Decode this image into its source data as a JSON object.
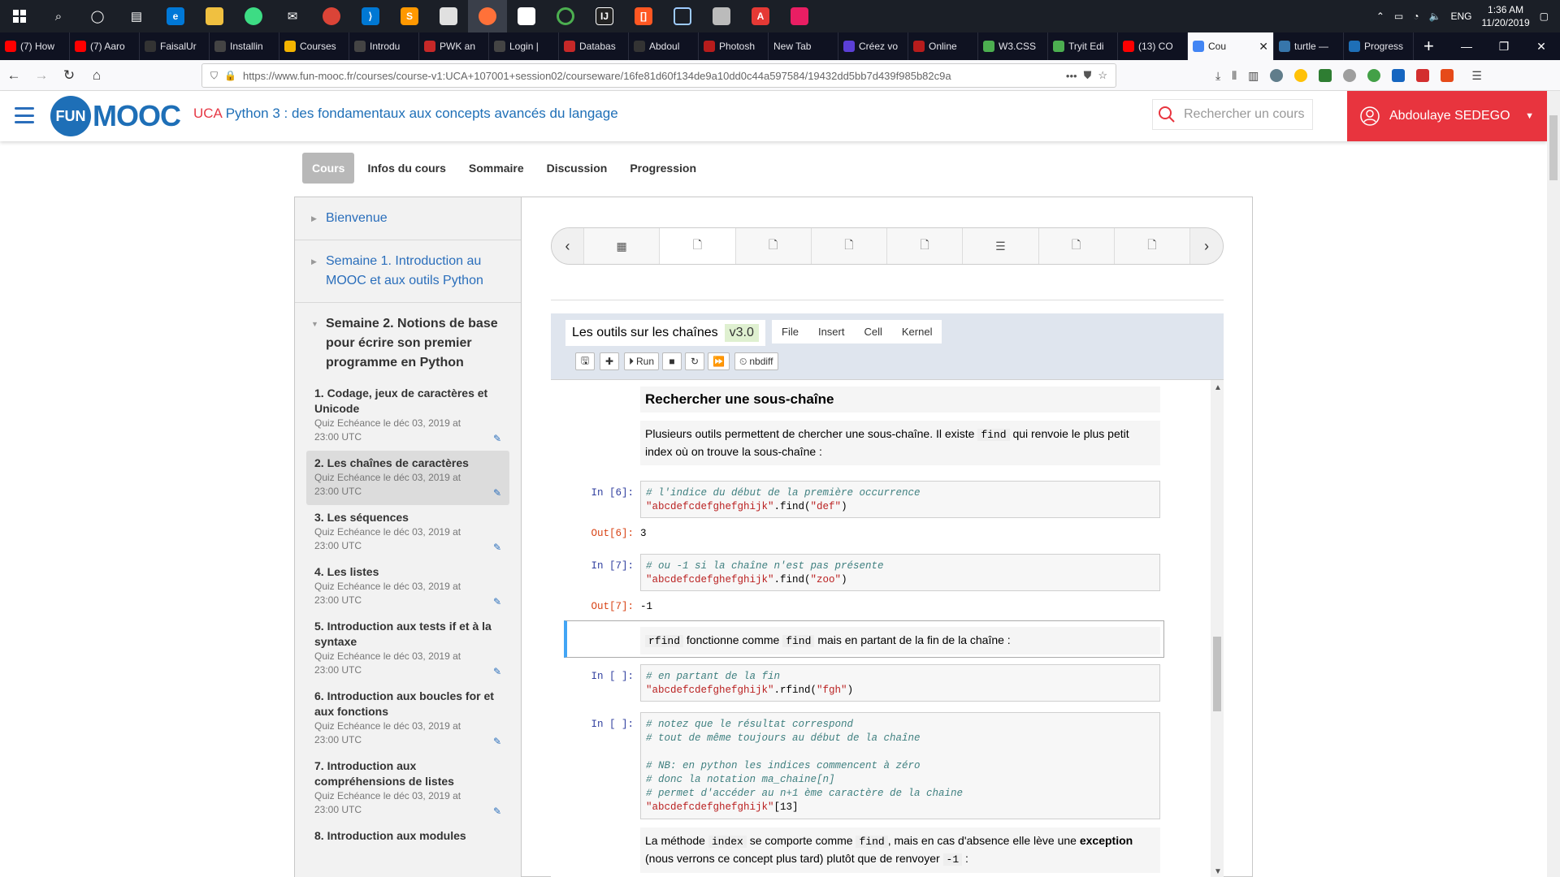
{
  "taskbar": {
    "apps": [
      "start-icon",
      "search-icon",
      "cortana-icon",
      "task-view-icon",
      "edge-icon",
      "file-explorer-icon",
      "android-studio-icon",
      "mail-icon",
      "chrome-icon",
      "vscode-icon",
      "sublime-icon",
      "file-icon",
      "firefox-icon",
      "store-icon",
      "circle-app-icon",
      "intellij-icon",
      "brackets-icon",
      "box-icon",
      "shield-app-icon",
      "pdf-icon",
      "app-icon"
    ],
    "lang": "ENG",
    "time": "1:36 AM",
    "date": "11/20/2019"
  },
  "tabs": [
    {
      "label": "(7) How",
      "icon": "youtube-icon",
      "color": "#ff0000"
    },
    {
      "label": "(7) Aaro",
      "icon": "youtube-icon",
      "color": "#ff0000"
    },
    {
      "label": "FaisalUr",
      "icon": "github-icon",
      "color": "#333333"
    },
    {
      "label": "Installin",
      "icon": "vscode-icon",
      "color": "#444444"
    },
    {
      "label": "Courses",
      "icon": "drive-icon",
      "color": "#f4b400"
    },
    {
      "label": "Introdu",
      "icon": "vscode-icon",
      "color": "#444444"
    },
    {
      "label": "PWK an",
      "icon": "pwk-icon",
      "color": "#c62828"
    },
    {
      "label": "Login | ",
      "icon": "vscode-icon",
      "color": "#444444"
    },
    {
      "label": "Databas",
      "icon": "pwk-icon",
      "color": "#c62828"
    },
    {
      "label": "Abdoul",
      "icon": "github-icon",
      "color": "#333333"
    },
    {
      "label": "Photosh",
      "icon": "photoshop-icon",
      "color": "#b71c1c"
    },
    {
      "label": "New Tab",
      "icon": "none",
      "color": "#0f1221"
    },
    {
      "label": "Créez vo",
      "icon": "canva-icon",
      "color": "#5b3fd6"
    },
    {
      "label": "Online ",
      "icon": "photoshop-icon",
      "color": "#b71c1c"
    },
    {
      "label": "W3.CSS",
      "icon": "w3-icon",
      "color": "#4caf50"
    },
    {
      "label": "Tryit Edi",
      "icon": "w3-icon",
      "color": "#4caf50"
    },
    {
      "label": "(13) CO",
      "icon": "youtube-icon",
      "color": "#ff0000"
    },
    {
      "label": "Cou",
      "icon": "chrome-icon",
      "color": "#4285f4",
      "active": true
    },
    {
      "label": "turtle —",
      "icon": "python-icon",
      "color": "#3776ab"
    },
    {
      "label": "Progress",
      "icon": "fun-icon",
      "color": "#1e6fb7"
    }
  ],
  "browser": {
    "url": "https://www.fun-mooc.fr/courses/course-v1:UCA+107001+session02/courseware/16fe81d60f134de9a10dd0c44a597584/19432dd5bb7d439f985b82c9a"
  },
  "site": {
    "logo_fun": "FUN",
    "logo_mooc": "MOOC",
    "course_prefix": "UCA",
    "course_title": "Python 3 : des fondamentaux aux concepts avancés du langage",
    "search_placeholder": "Rechercher un cours",
    "user": "Abdoulaye SEDEGO",
    "nav": [
      "Cours",
      "Infos du cours",
      "Sommaire",
      "Discussion",
      "Progression"
    ]
  },
  "sidebar": {
    "chapters": [
      {
        "label": "Bienvenue"
      },
      {
        "label": "Semaine 1. Introduction au MOOC et aux outils Python"
      },
      {
        "label": "Semaine 2. Notions de base pour écrire son premier programme en Python"
      }
    ],
    "sequences": [
      {
        "title": "1. Codage, jeux de caractères et Unicode",
        "due": "Quiz Echéance le déc 03, 2019 at 23:00 UTC"
      },
      {
        "title": "2. Les chaînes de caractères",
        "due": "Quiz Echéance le déc 03, 2019 at 23:00 UTC",
        "active": true
      },
      {
        "title": "3. Les séquences",
        "due": "Quiz Echéance le déc 03, 2019 at 23:00 UTC"
      },
      {
        "title": "4. Les listes",
        "due": "Quiz Echéance le déc 03, 2019 at 23:00 UTC"
      },
      {
        "title": "5. Introduction aux tests if et à la syntaxe",
        "due": "Quiz Echéance le déc 03, 2019 at 23:00 UTC"
      },
      {
        "title": "6. Introduction aux boucles for et aux fonctions",
        "due": "Quiz Echéance le déc 03, 2019 at 23:00 UTC"
      },
      {
        "title": "7. Introduction aux compréhensions de listes",
        "due": "Quiz Echéance le déc 03, 2019 at 23:00 UTC"
      },
      {
        "title": "8. Introduction aux modules",
        "due": ""
      }
    ]
  },
  "unit_nav": {
    "prev": "‹",
    "next": "›",
    "units": [
      "video-icon",
      "page-icon",
      "page-icon",
      "page-icon",
      "page-icon",
      "list-icon",
      "page-icon",
      "page-icon"
    ],
    "active_index": 1
  },
  "notebook": {
    "title": "Les outils sur les chaînes",
    "version": "v3.0",
    "menu": [
      "File",
      "Insert",
      "Cell",
      "Kernel"
    ],
    "tools": {
      "run": "Run",
      "nbdiff": "nbdiff"
    },
    "heading": "Rechercher une sous-chaîne",
    "md1_a": "Plusieurs outils permettent de chercher une sous-chaîne. Il existe",
    "md1_code": "find",
    "md1_b": "qui renvoie le plus petit index où on trouve la sous-chaîne :",
    "cell1": {
      "prompt": "In [6]:",
      "comment": "# l'indice du début de la première occurrence",
      "str": "\"abcdefcdefghefghijk\"",
      "method": ".find(",
      "arg": "\"def\"",
      "close": ")",
      "out_prompt": "Out[6]:",
      "out": "3"
    },
    "cell2": {
      "prompt": "In [7]:",
      "comment": "# ou -1 si la chaîne n'est pas présente",
      "str": "\"abcdefcdefghefghijk\"",
      "method": ".find(",
      "arg": "\"zoo\"",
      "close": ")",
      "out_prompt": "Out[7]:",
      "out": "-1"
    },
    "md2_code1": "rfind",
    "md2_a": "fonctionne comme",
    "md2_code2": "find",
    "md2_b": "mais en partant de la fin de la chaîne :",
    "cell3": {
      "prompt": "In [ ]:",
      "comment": "# en partant de la fin",
      "str": "\"abcdefcdefghefghijk\"",
      "method": ".rfind(",
      "arg": "\"fgh\"",
      "close": ")"
    },
    "cell4": {
      "prompt": "In [ ]:",
      "c1": "# notez que le résultat correspond",
      "c2": "# tout de même toujours au début de la chaîne",
      "c3": "# NB: en python les indices commencent à zéro",
      "c4": "# donc la notation ma_chaine[n]",
      "c5": "# permet d'accéder au n+1 ème caractère de la chaine",
      "str": "\"abcdefcdefghefghijk\"",
      "idx": "[13]"
    },
    "md3_a": "La méthode",
    "md3_code1": "index",
    "md3_b": "se comporte comme",
    "md3_code2": "find",
    "md3_c": ", mais en cas d'absence elle lève une",
    "md3_bold": "exception",
    "md3_d": "(nous verrons ce concept plus tard) plutôt que de renvoyer",
    "md3_code3": "-1",
    "md3_e": ":"
  }
}
